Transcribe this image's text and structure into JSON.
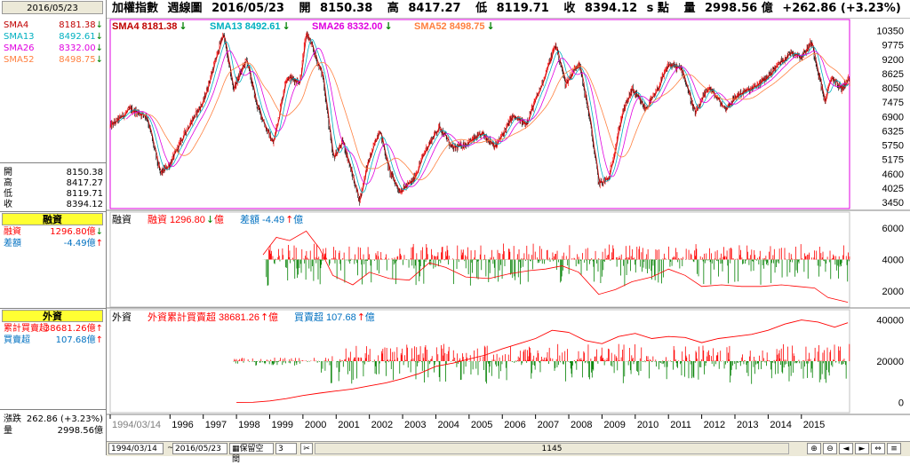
{
  "left_panel": {
    "date": "2016/05/23",
    "sma": [
      {
        "label": "SMA4",
        "value": "8181.38",
        "arrow": "down",
        "color": "#c00000"
      },
      {
        "label": "SMA13",
        "value": "8492.61",
        "arrow": "down",
        "color": "#00b0c0"
      },
      {
        "label": "SMA26",
        "value": "8332.00",
        "arrow": "down",
        "color": "#e000e0"
      },
      {
        "label": "SMA52",
        "value": "8498.75",
        "arrow": "down",
        "color": "#ff8040"
      }
    ],
    "ohlc": [
      {
        "label": "開",
        "value": "8150.38"
      },
      {
        "label": "高",
        "value": "8417.27"
      },
      {
        "label": "低",
        "value": "8119.71"
      },
      {
        "label": "收",
        "value": "8394.12"
      }
    ],
    "margin_header": "融資",
    "margin": [
      {
        "label": "融資",
        "value": "1296.80億",
        "arrow": "down",
        "color": "#ff0000"
      },
      {
        "label": "差額",
        "value": "-4.49億",
        "arrow": "up",
        "color": "#0070c0"
      }
    ],
    "foreign_header": "外資",
    "foreign": [
      {
        "label": "累計買賣超",
        "value": "38681.26億",
        "arrow": "up",
        "color": "#ff0000"
      },
      {
        "label": "買賣超",
        "value": "107.68億",
        "arrow": "up",
        "color": "#0070c0"
      }
    ],
    "change": {
      "label": "漲跌",
      "value": "262.86 (+3.23%)"
    },
    "volume": {
      "label": "量",
      "value": "2998.56億"
    }
  },
  "topbar": {
    "name": "加權指數",
    "period": "週線圖",
    "date": "2016/05/23",
    "open_label": "開",
    "open": "8150.38",
    "high_label": "高",
    "high": "8417.27",
    "low_label": "低",
    "low": "8119.71",
    "close_label": "收",
    "close": "8394.12",
    "unit": "s 點",
    "vol_label": "量",
    "vol": "2998.56 億",
    "change": "+262.86 (+3.23%)"
  },
  "panels": {
    "price_legend": [
      {
        "text": "SMA4 8181.38",
        "color": "#c00000",
        "arrow": "down"
      },
      {
        "text": "SMA13 8492.61",
        "color": "#00b0c0",
        "arrow": "down"
      },
      {
        "text": "SMA26 8332.00",
        "color": "#e000e0",
        "arrow": "down"
      },
      {
        "text": "SMA52 8498.75",
        "color": "#ff8040",
        "arrow": "down"
      }
    ],
    "margin_title": "融資",
    "margin_legend": [
      {
        "text": "融資 1296.80",
        "unit": "億",
        "color": "#ff0000",
        "arrow": "down"
      },
      {
        "text": "差額 -4.49",
        "unit": "億",
        "color": "#0070c0",
        "arrow": "up"
      }
    ],
    "foreign_title": "外資",
    "foreign_legend": [
      {
        "text": "外資累計買賣超 38681.26",
        "unit": "億",
        "color": "#ff0000",
        "arrow": "up"
      },
      {
        "text": "買賣超 107.68",
        "unit": "億",
        "color": "#0070c0",
        "arrow": "up"
      }
    ]
  },
  "statusbar": {
    "start": "1994/03/14",
    "end": "2016/05/23",
    "mode": "保留空間",
    "mode_num": "3",
    "count": "1145"
  },
  "chart_data": [
    {
      "type": "candlestick",
      "title": "加權指數 週線圖",
      "x_axis_labels": [
        "1994/03/14",
        "1996",
        "1997",
        "1998",
        "1999",
        "2000",
        "2001",
        "2002",
        "2003",
        "2004",
        "2005",
        "2006",
        "2007",
        "2008",
        "2009",
        "2010",
        "2011",
        "2012",
        "2013",
        "2014",
        "2015"
      ],
      "y_ticks": [
        3450,
        4025,
        4600,
        5175,
        5750,
        6325,
        6900,
        7475,
        8050,
        8625,
        9200,
        9775,
        10350
      ],
      "ylim": [
        3200,
        10800
      ],
      "price_path": [
        [
          1994.2,
          6500
        ],
        [
          1994.8,
          7200
        ],
        [
          1995.3,
          6900
        ],
        [
          1995.7,
          4600
        ],
        [
          1996.0,
          5000
        ],
        [
          1996.5,
          6400
        ],
        [
          1997.0,
          7500
        ],
        [
          1997.6,
          10250
        ],
        [
          1997.9,
          8000
        ],
        [
          1998.3,
          9200
        ],
        [
          1998.6,
          7400
        ],
        [
          1998.9,
          6400
        ],
        [
          1999.1,
          5800
        ],
        [
          1999.5,
          8500
        ],
        [
          1999.9,
          8300
        ],
        [
          2000.1,
          10300
        ],
        [
          2000.6,
          8500
        ],
        [
          2000.9,
          5200
        ],
        [
          2001.2,
          5900
        ],
        [
          2001.7,
          3500
        ],
        [
          2001.9,
          4800
        ],
        [
          2002.3,
          6400
        ],
        [
          2002.6,
          4700
        ],
        [
          2002.9,
          3900
        ],
        [
          2003.3,
          4300
        ],
        [
          2003.7,
          5600
        ],
        [
          2004.1,
          6500
        ],
        [
          2004.5,
          5600
        ],
        [
          2004.9,
          5800
        ],
        [
          2005.4,
          6200
        ],
        [
          2005.8,
          5700
        ],
        [
          2006.3,
          6900
        ],
        [
          2006.7,
          6600
        ],
        [
          2007.1,
          7900
        ],
        [
          2007.6,
          9800
        ],
        [
          2007.9,
          8200
        ],
        [
          2008.3,
          9100
        ],
        [
          2008.6,
          7000
        ],
        [
          2008.9,
          4200
        ],
        [
          2009.2,
          4400
        ],
        [
          2009.6,
          7000
        ],
        [
          2009.9,
          8000
        ],
        [
          2010.3,
          7200
        ],
        [
          2010.6,
          7800
        ],
        [
          2011.0,
          9000
        ],
        [
          2011.4,
          8800
        ],
        [
          2011.8,
          7000
        ],
        [
          2012.2,
          8100
        ],
        [
          2012.7,
          7200
        ],
        [
          2013.1,
          7800
        ],
        [
          2013.5,
          8000
        ],
        [
          2013.9,
          8400
        ],
        [
          2014.3,
          9000
        ],
        [
          2014.7,
          9500
        ],
        [
          2015.0,
          9300
        ],
        [
          2015.3,
          9900
        ],
        [
          2015.7,
          7500
        ],
        [
          2015.9,
          8500
        ],
        [
          2016.2,
          8000
        ],
        [
          2016.4,
          8400
        ]
      ],
      "last": {
        "open": 8150.38,
        "high": 8417.27,
        "low": 8119.71,
        "close": 8394.12
      },
      "series": [
        {
          "name": "SMA4",
          "value": 8181.38,
          "color": "#c00000"
        },
        {
          "name": "SMA13",
          "value": 8492.61,
          "color": "#00b0c0"
        },
        {
          "name": "SMA26",
          "value": 8332.0,
          "color": "#e000e0"
        },
        {
          "name": "SMA52",
          "value": 8498.75,
          "color": "#ff8040"
        }
      ]
    },
    {
      "type": "bar+line",
      "title": "融資",
      "y_ticks": [
        2000,
        4000,
        6000
      ],
      "ylim": [
        1000,
        7000
      ],
      "balance_path": [
        [
          1998.8,
          4300
        ],
        [
          1999.2,
          5400
        ],
        [
          1999.6,
          5200
        ],
        [
          2000.1,
          5800
        ],
        [
          2000.5,
          4700
        ],
        [
          2000.9,
          3000
        ],
        [
          2001.5,
          2400
        ],
        [
          2002.0,
          3200
        ],
        [
          2002.6,
          2800
        ],
        [
          2003.2,
          2700
        ],
        [
          2003.8,
          3800
        ],
        [
          2004.3,
          3500
        ],
        [
          2004.9,
          2900
        ],
        [
          2005.6,
          2800
        ],
        [
          2006.2,
          3100
        ],
        [
          2006.8,
          3300
        ],
        [
          2007.3,
          3400
        ],
        [
          2007.8,
          3600
        ],
        [
          2008.3,
          3200
        ],
        [
          2008.9,
          1800
        ],
        [
          2009.4,
          2100
        ],
        [
          2009.9,
          2600
        ],
        [
          2010.5,
          2900
        ],
        [
          2011.0,
          3400
        ],
        [
          2011.5,
          3000
        ],
        [
          2012.0,
          2300
        ],
        [
          2012.6,
          2400
        ],
        [
          2013.2,
          2300
        ],
        [
          2013.8,
          2300
        ],
        [
          2014.4,
          2400
        ],
        [
          2014.9,
          2300
        ],
        [
          2015.4,
          2200
        ],
        [
          2015.8,
          1600
        ],
        [
          2016.4,
          1300
        ]
      ],
      "series": [
        {
          "name": "融資",
          "value": 1296.8,
          "unit": "億",
          "color": "#ff0000"
        },
        {
          "name": "差額",
          "value": -4.49,
          "unit": "億",
          "color": "#0070c0"
        }
      ]
    },
    {
      "type": "bar+line",
      "title": "外資",
      "y_ticks": [
        0,
        20000,
        40000
      ],
      "ylim": [
        -5000,
        45000
      ],
      "cumulative_path": [
        [
          1998.0,
          0
        ],
        [
          1998.5,
          50
        ],
        [
          1999.0,
          700
        ],
        [
          1999.5,
          1800
        ],
        [
          2000.0,
          3300
        ],
        [
          2000.5,
          4500
        ],
        [
          2001.0,
          5500
        ],
        [
          2001.5,
          6500
        ],
        [
          2002.0,
          8000
        ],
        [
          2002.5,
          9500
        ],
        [
          2003.0,
          11500
        ],
        [
          2003.5,
          14000
        ],
        [
          2004.0,
          17500
        ],
        [
          2004.5,
          19000
        ],
        [
          2005.0,
          21000
        ],
        [
          2005.5,
          23000
        ],
        [
          2006.0,
          26000
        ],
        [
          2006.5,
          28500
        ],
        [
          2007.0,
          31000
        ],
        [
          2007.5,
          35000
        ],
        [
          2008.0,
          34000
        ],
        [
          2008.5,
          30000
        ],
        [
          2009.0,
          28500
        ],
        [
          2009.5,
          32000
        ],
        [
          2010.0,
          33500
        ],
        [
          2010.5,
          31000
        ],
        [
          2011.0,
          32000
        ],
        [
          2011.5,
          31500
        ],
        [
          2012.0,
          29000
        ],
        [
          2012.5,
          31000
        ],
        [
          2013.0,
          32000
        ],
        [
          2013.5,
          33000
        ],
        [
          2014.0,
          35000
        ],
        [
          2014.5,
          38000
        ],
        [
          2015.0,
          40000
        ],
        [
          2015.5,
          39000
        ],
        [
          2016.0,
          36500
        ],
        [
          2016.4,
          38681
        ]
      ],
      "series": [
        {
          "name": "外資累計買賣超",
          "value": 38681.26,
          "unit": "億",
          "color": "#ff0000"
        },
        {
          "name": "買賣超",
          "value": 107.68,
          "unit": "億",
          "color": "#0070c0"
        }
      ]
    }
  ]
}
